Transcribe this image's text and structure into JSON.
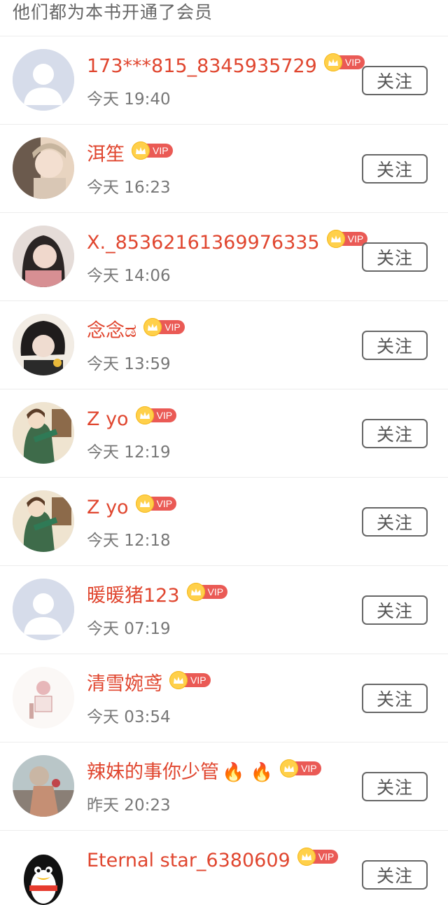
{
  "header": {
    "title": "他们都为本书开通了会员"
  },
  "vip_label": "VIP",
  "follow_label": "关注",
  "colors": {
    "name": "#e0462f",
    "vip_tag": "#ea5a55",
    "crown": "#ffd04a"
  },
  "members": [
    {
      "name": "173***815_8345935729",
      "emoji": "",
      "time": "今天 19:40",
      "avatar": "default-avatar"
    },
    {
      "name": "洱笙",
      "emoji": "",
      "time": "今天 16:23",
      "avatar": "photo-avatar"
    },
    {
      "name": "X._85362161369976335",
      "emoji": "",
      "time": "今天 14:06",
      "avatar": "photo-avatar"
    },
    {
      "name": "念念ಡ",
      "emoji": "",
      "time": "今天 13:59",
      "avatar": "photo-avatar"
    },
    {
      "name": "Z yo",
      "emoji": "",
      "time": "今天 12:19",
      "avatar": "illustration-avatar"
    },
    {
      "name": "Z yo",
      "emoji": "",
      "time": "今天 12:18",
      "avatar": "illustration-avatar"
    },
    {
      "name": "暖暖猪123",
      "emoji": "",
      "time": "今天 07:19",
      "avatar": "default-avatar"
    },
    {
      "name": "清雪婉鸢",
      "emoji": "",
      "time": "今天 03:54",
      "avatar": "illustration-avatar"
    },
    {
      "name": "辣妹的事你少管",
      "emoji": "🔥 🔥",
      "time": "昨天 20:23",
      "avatar": "photo-avatar"
    },
    {
      "name": "Eternal star_6380609",
      "emoji": "",
      "time": "",
      "avatar": "penguin-avatar"
    }
  ]
}
